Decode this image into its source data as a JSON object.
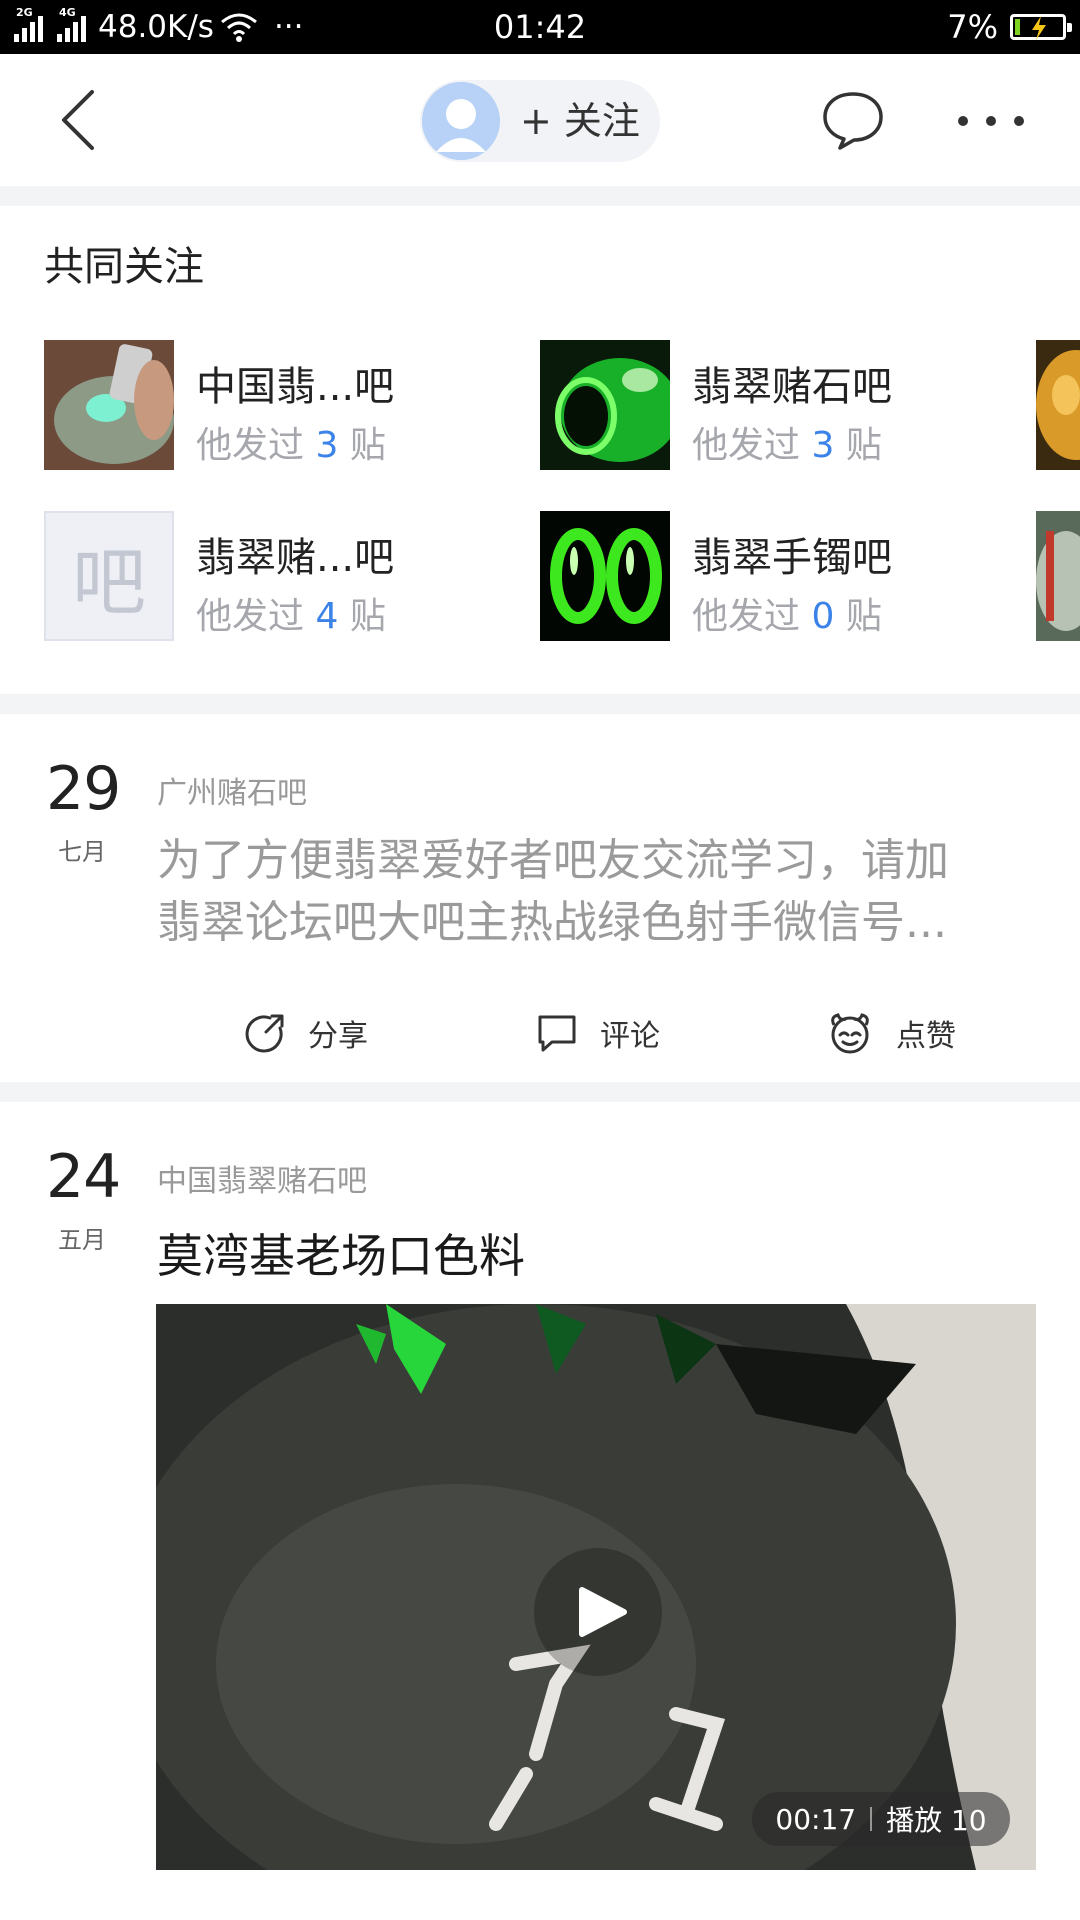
{
  "status_bar": {
    "net_2g": "2G",
    "net_4g": "4G",
    "speed": "48.0K/s",
    "more": "···",
    "time": "01:42",
    "battery": "7%"
  },
  "nav": {
    "follow_label": "+ 关注"
  },
  "common_follows": {
    "title": "共同关注",
    "bars": [
      {
        "name": "中国翡...吧",
        "prefix": "他发过",
        "count": "3",
        "suffix": "贴"
      },
      {
        "name": "翡翠赌石吧",
        "prefix": "他发过",
        "count": "3",
        "suffix": "贴"
      },
      {
        "name": "翡翠赌...吧",
        "prefix": "他发过",
        "count": "4",
        "suffix": "贴",
        "placeholder": "吧"
      },
      {
        "name": "翡翠手镯吧",
        "prefix": "他发过",
        "count": "0",
        "suffix": "贴"
      }
    ]
  },
  "posts": [
    {
      "day": "29",
      "month": "七月",
      "bar": "广州赌石吧",
      "body_line1": "为了方便翡翠爱好者吧友交流学习，请加",
      "body_line2": "翡翠论坛吧大吧主热战绿色射手微信号...",
      "actions": {
        "share": "分享",
        "comment": "评论",
        "like": "点赞"
      }
    },
    {
      "day": "24",
      "month": "五月",
      "bar": "中国翡翠赌石吧",
      "title": "莫湾基老场口色料",
      "video": {
        "duration": "00:17",
        "plays": "播放 10"
      }
    }
  ]
}
